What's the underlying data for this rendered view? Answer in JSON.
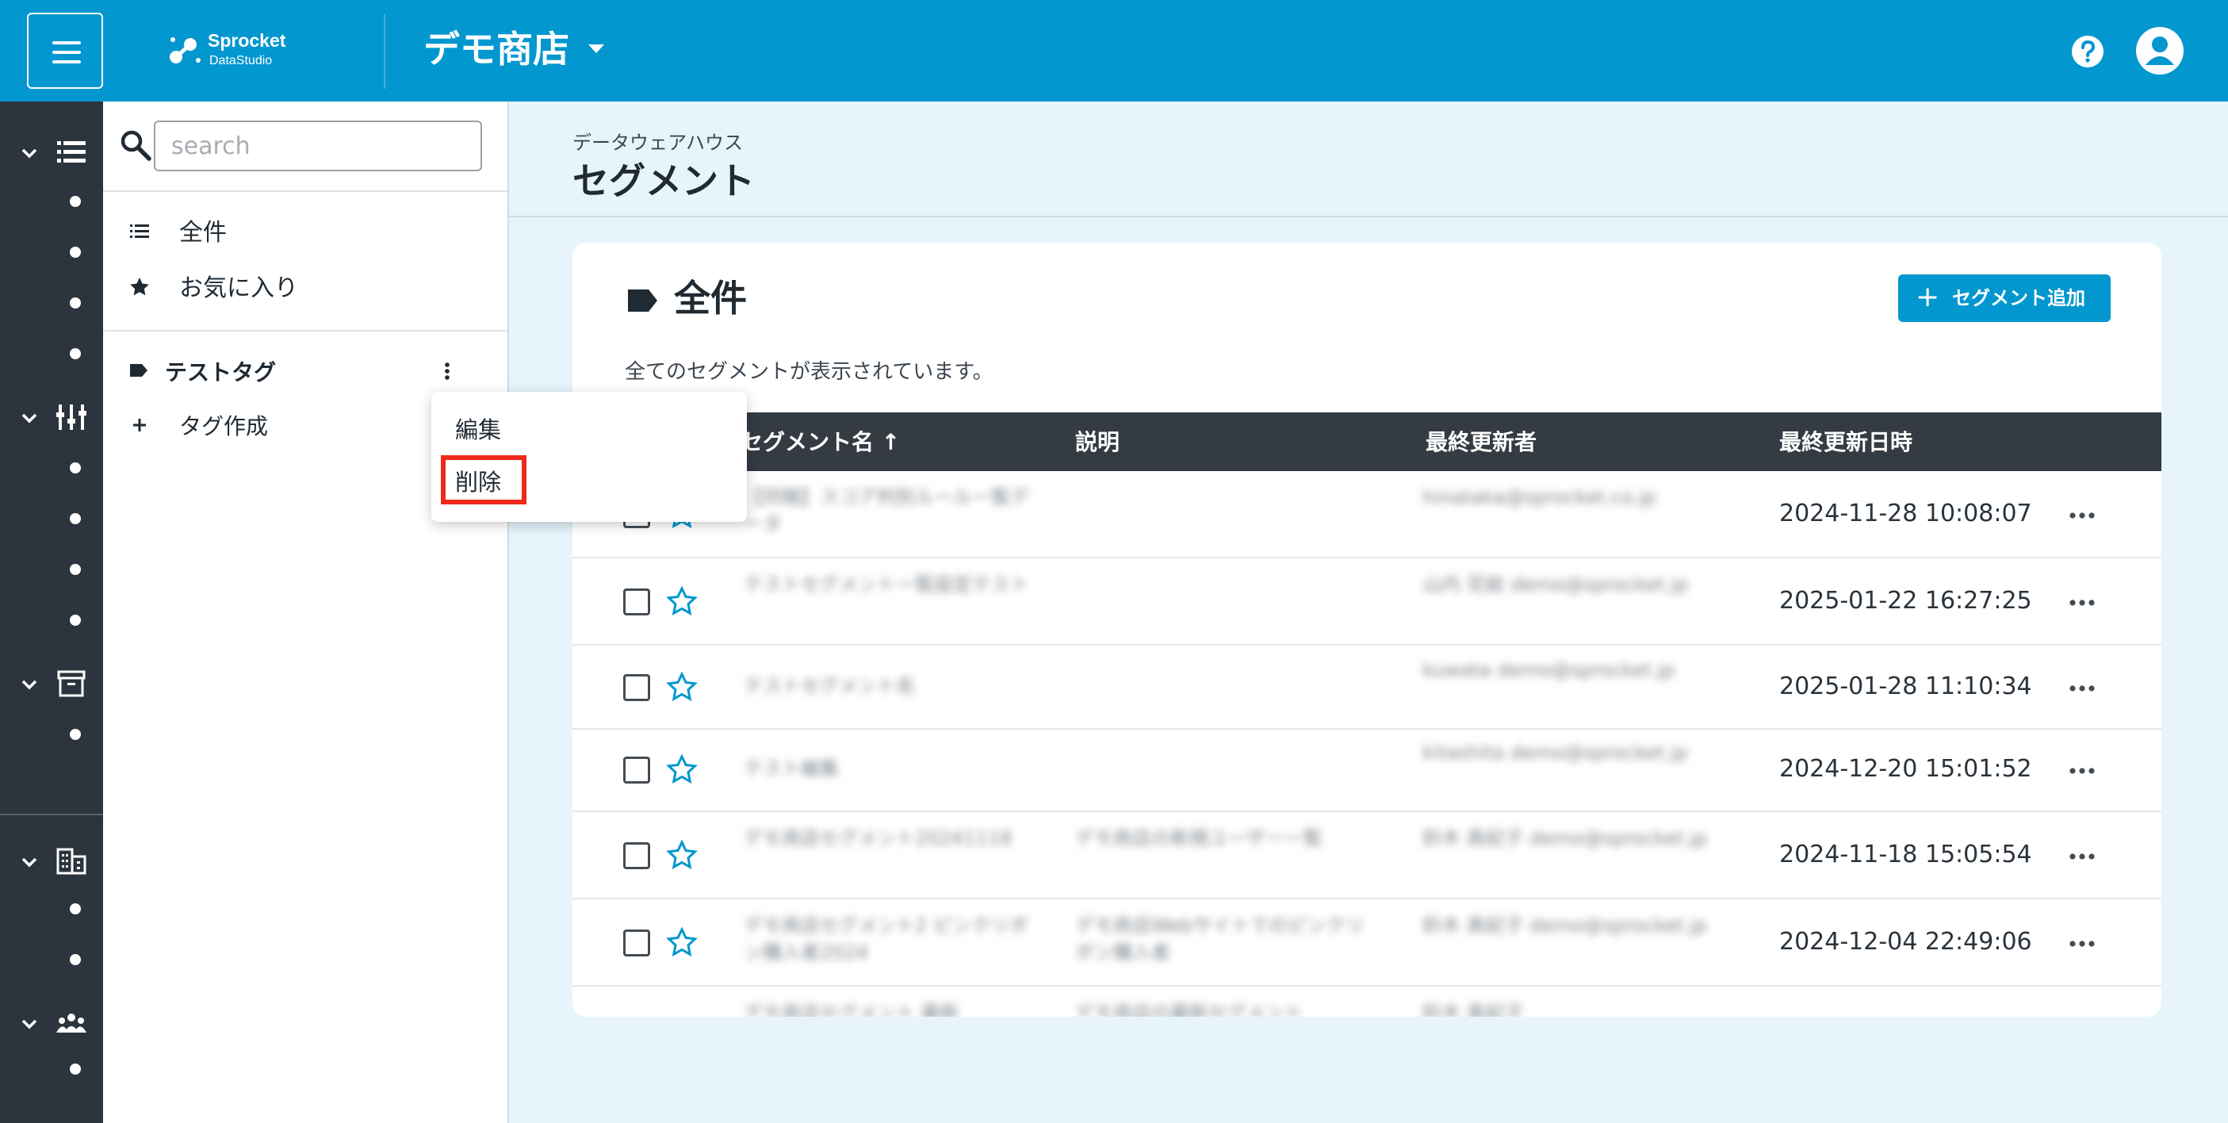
{
  "header": {
    "logo_name": "Sprocket",
    "logo_sub": "DataStudio",
    "store_name": "デモ商店"
  },
  "search": {
    "placeholder": "search"
  },
  "panel": {
    "all_label": "全件",
    "favorites_label": "お気に入り",
    "tag_label": "テストタグ",
    "create_tag_label": "タグ作成"
  },
  "menu": {
    "edit_label": "編集",
    "delete_label": "削除"
  },
  "page": {
    "breadcrumb": "データウェアハウス",
    "title": "セグメント"
  },
  "card": {
    "title": "全件",
    "add_button": "セグメント追加",
    "description": "全てのセグメントが表示されています。"
  },
  "table": {
    "columns": [
      "セグメント名 ↑",
      "説明",
      "最終更新者",
      "最終更新日時"
    ],
    "rows": [
      {
        "name": "【同梱】スコア判別ルール一覧データ",
        "description": "",
        "updater": "hinataka@sprocket.co.jp",
        "updated_at": "2024-11-28 10:08:07"
      },
      {
        "name": "テストセグメント一覧設定テスト",
        "description": "",
        "updater": "山内 花絵 demo@sprocket.jp",
        "updated_at": "2025-01-22 16:27:25"
      },
      {
        "name": "テストセグメント名",
        "description": "",
        "updater": "kuwata demo@sprocket.jp",
        "updated_at": "2025-01-28 11:10:34"
      },
      {
        "name": "テスト編集",
        "description": "",
        "updater": "kitashita demo@sprocket.jp",
        "updated_at": "2024-12-20 15:01:52"
      },
      {
        "name": "デモ商店セグメント20241118",
        "description": "デモ商店の新規ユーザー一覧",
        "updater": "鈴木 真紀子 demo@sprocket.jp",
        "updated_at": "2024-11-18 15:05:54"
      },
      {
        "name": "デモ商店セグメント2 ピンクリボン購入者2024",
        "description": "デモ商店Webサイトでのピンクリボン購入者",
        "updater": "鈴木 真紀子 demo@sprocket.jp",
        "updated_at": "2024-12-04 22:49:06"
      },
      {
        "name": "デモ商店セグメント 最新",
        "description": "デモ商店の最新セグメント",
        "updater": "鈴木 真紀子",
        "updated_at": ""
      }
    ]
  }
}
